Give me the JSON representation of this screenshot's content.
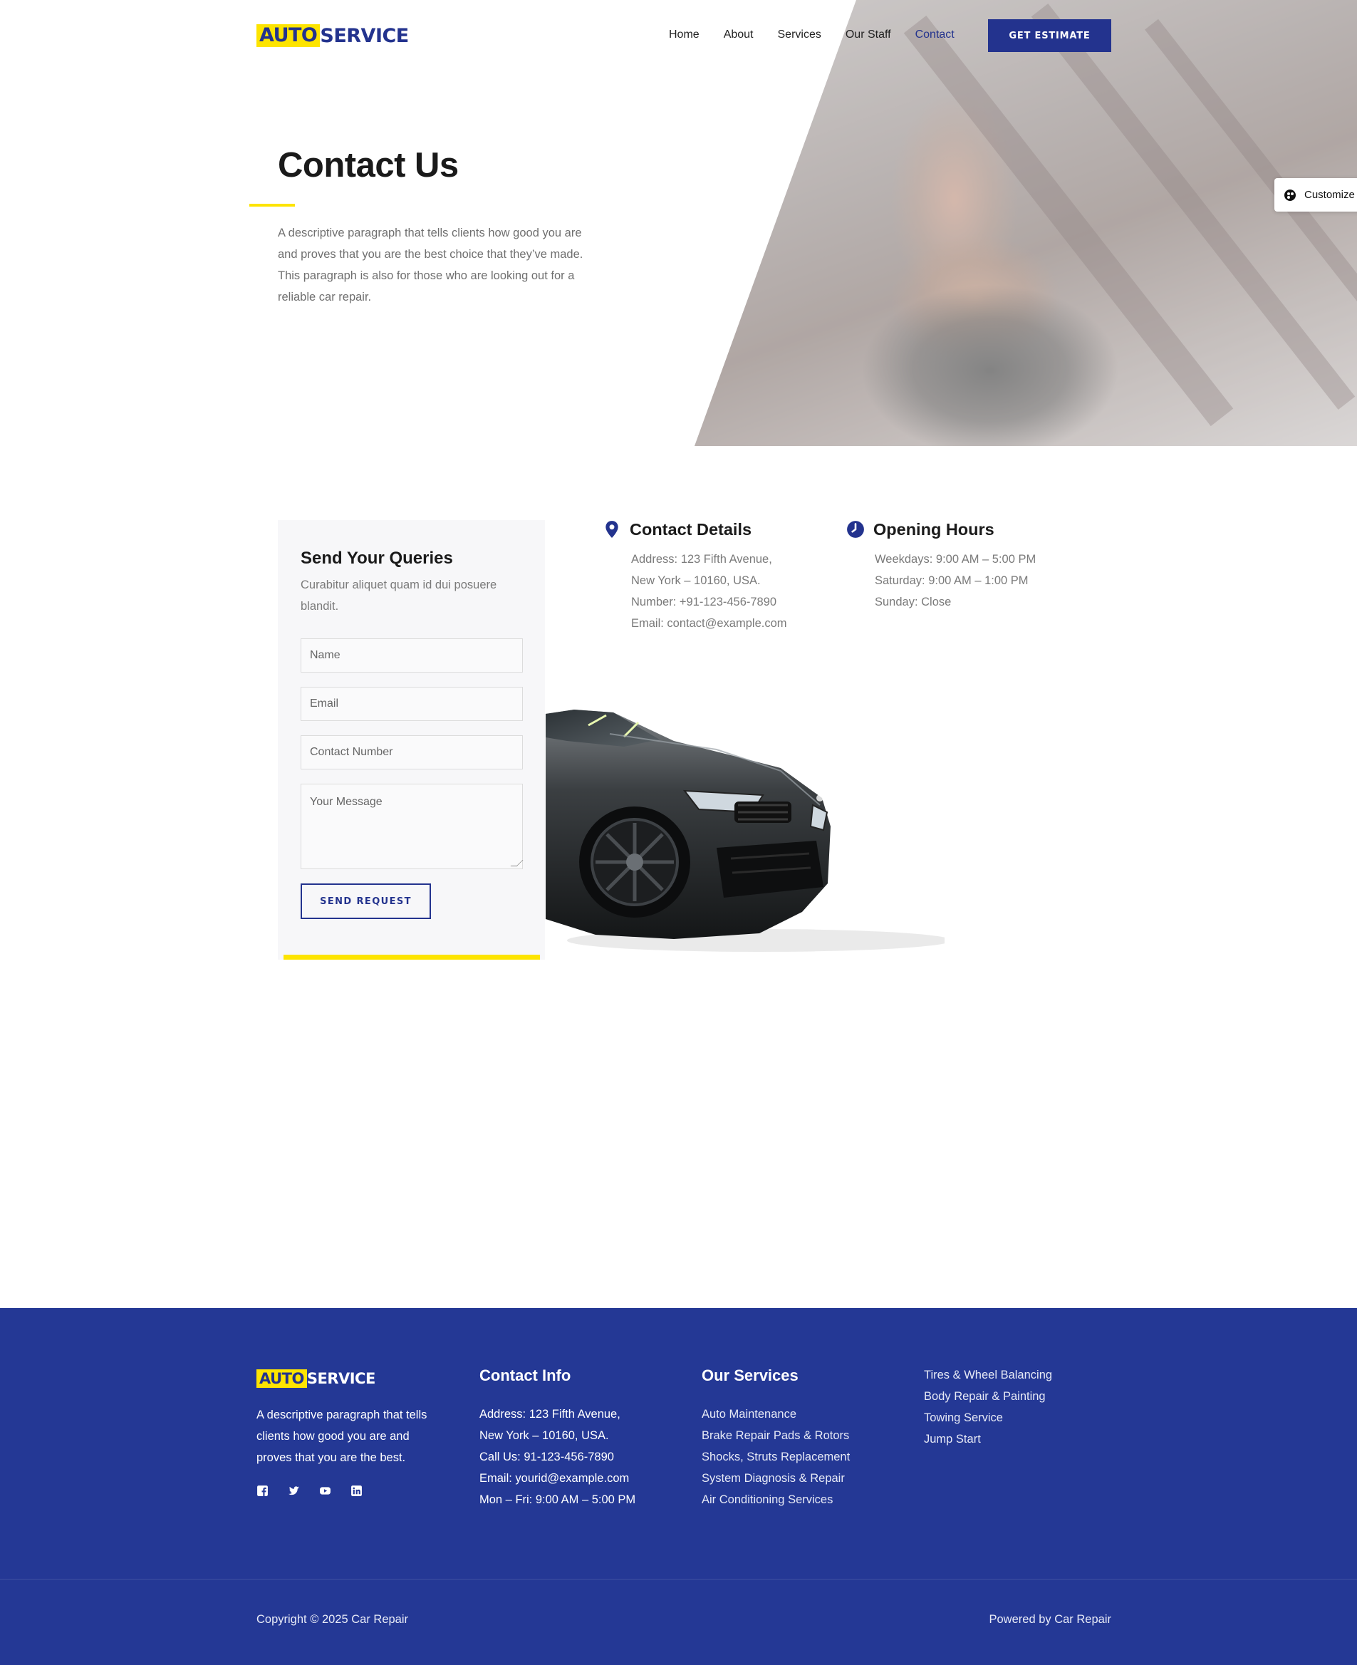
{
  "header": {
    "logo": {
      "part1": "AUTO",
      "part2": "SERVICE"
    },
    "nav": [
      "Home",
      "About",
      "Services",
      "Our Staff",
      "Contact"
    ],
    "active_nav": "Contact",
    "cta_label": "GET ESTIMATE"
  },
  "customize_label": "Customize",
  "hero": {
    "title": "Contact Us",
    "description": "A descriptive paragraph that tells clients how good you are and proves that you are the best choice that they’ve made. This paragraph is also for those who are looking out for a reliable car repair."
  },
  "form": {
    "title": "Send Your Queries",
    "subtitle": "Curabitur aliquet quam id dui posuere blandit.",
    "name_placeholder": "Name",
    "email_placeholder": "Email",
    "number_placeholder": "Contact Number",
    "message_placeholder": "Your Message",
    "submit_label": "SEND REQUEST"
  },
  "contact_details": {
    "heading": "Contact Details",
    "lines": [
      "Address: 123 Fifth Avenue,",
      "New York – 10160, USA.",
      "Number: +91-123-456-7890",
      "Email: contact@example.com"
    ]
  },
  "opening_hours": {
    "heading": "Opening Hours",
    "lines": [
      "Weekdays: 9:00 AM – 5:00 PM",
      "Saturday: 9:00 AM – 1:00 PM",
      "Sunday: Close"
    ]
  },
  "footer": {
    "logo": {
      "part1": "AUTO",
      "part2": "SERVICE"
    },
    "about": [
      "A descriptive paragraph that tells",
      "clients how good you are and",
      "proves that you are the best."
    ],
    "social_icons": [
      "facebook-icon",
      "twitter-icon",
      "youtube-icon",
      "linkedin-icon"
    ],
    "contact_heading": "Contact Info",
    "contact_lines": [
      "Address: 123 Fifth Avenue,",
      "New York – 10160, USA.",
      "Call Us: 91-123-456-7890",
      "Email: yourid@example.com",
      "Mon – Fri: 9:00 AM – 5:00 PM"
    ],
    "services_heading": "Our Services",
    "services": [
      "Auto Maintenance",
      "Brake Repair Pads & Rotors",
      "Shocks, Struts Replacement",
      "System Diagnosis & Repair",
      "Air Conditioning Services"
    ],
    "services_more": [
      "Tires & Wheel Balancing",
      "Body Repair & Painting",
      "Towing Service",
      "Jump Start"
    ],
    "copyright": "Copyright © 2025 Car Repair",
    "powered": "Powered by Car Repair"
  },
  "colors": {
    "brand_blue": "#23338e",
    "footer_blue": "#243895",
    "accent_yellow": "#fde400"
  }
}
